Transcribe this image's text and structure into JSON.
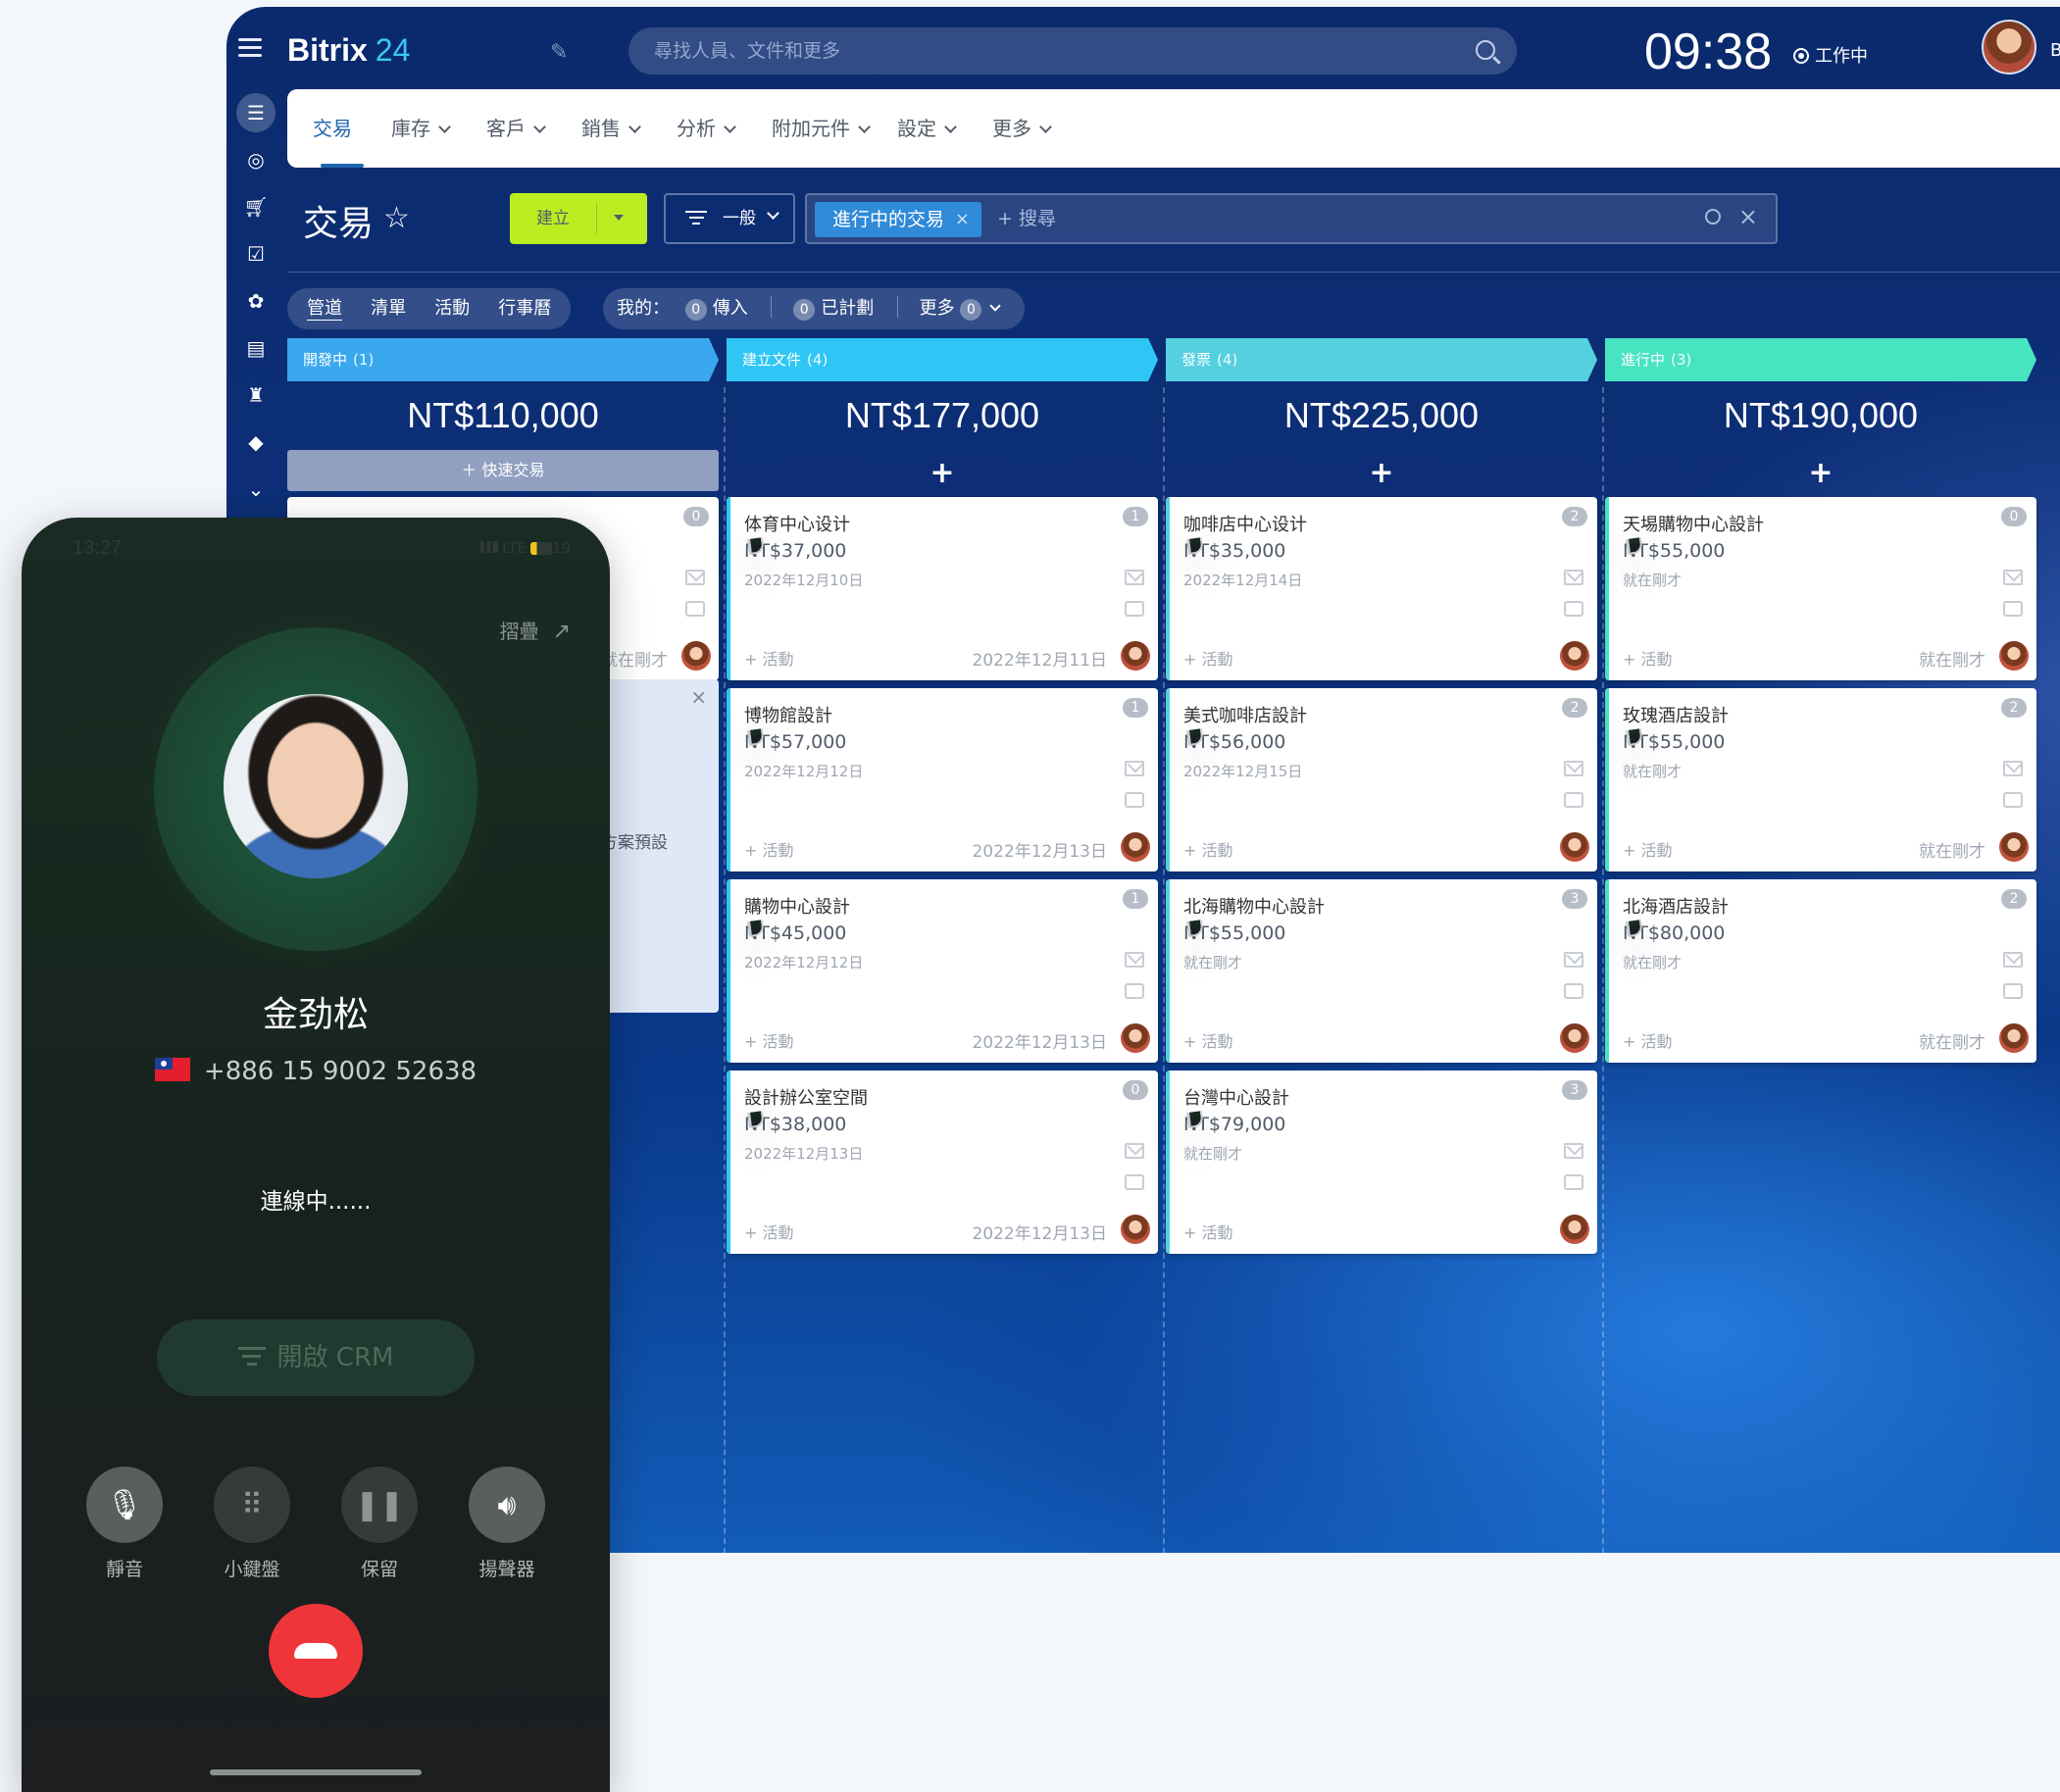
{
  "app": {
    "brand": "Bitrix",
    "brand_num": "24",
    "search_placeholder": "尋找人員、文件和更多",
    "clock": "09:38",
    "work_status": "工作中",
    "topbar_tail": "B"
  },
  "menu": [
    {
      "label": "交易",
      "active": true
    },
    {
      "label": "庫存"
    },
    {
      "label": "客戶"
    },
    {
      "label": "銷售"
    },
    {
      "label": "分析"
    },
    {
      "label": "附加元件"
    },
    {
      "label": "設定"
    },
    {
      "label": "更多"
    }
  ],
  "toolbar": {
    "title": "交易",
    "create": "建立",
    "filter": "一般",
    "chip": "進行中的交易",
    "search": "+ 搜尋"
  },
  "views": [
    "管道",
    "清單",
    "活動",
    "行事曆"
  ],
  "counters": {
    "mine": "我的：",
    "incoming_count": "0",
    "incoming": "傳入",
    "planned_count": "0",
    "planned": "已計劃",
    "more": "更多",
    "more_count": "0"
  },
  "columns": [
    {
      "name": "開發中",
      "count": "(1)",
      "sum": "NT$110,000",
      "color": "#39a8ef",
      "quick": "快速交易",
      "cards": [
        {
          "badge": "0",
          "date2": "就在剛才"
        }
      ],
      "partial": "方案預設"
    },
    {
      "name": "建立文件",
      "count": "(4)",
      "sum": "NT$177,000",
      "color": "#2fc6f6",
      "plus": "+",
      "cards": [
        {
          "title": "体育中心设计",
          "price": "NT$37,000",
          "date": "2022年12月10日",
          "act": "+ 活動",
          "date2": "2022年12月11日",
          "badge": "1"
        },
        {
          "title": "博物館設計",
          "price": "NT$57,000",
          "date": "2022年12月12日",
          "act": "+ 活動",
          "date2": "2022年12月13日",
          "badge": "1"
        },
        {
          "title": "購物中心設計",
          "price": "NT$45,000",
          "date": "2022年12月12日",
          "act": "+ 活動",
          "date2": "2022年12月13日",
          "badge": "1"
        },
        {
          "title": "設計辦公室空間",
          "price": "NT$38,000",
          "date": "2022年12月13日",
          "act": "+ 活動",
          "date2": "2022年12月13日",
          "badge": "0"
        }
      ]
    },
    {
      "name": "發票",
      "count": "(4)",
      "sum": "NT$225,000",
      "color": "#55d0e0",
      "plus": "+",
      "cards": [
        {
          "title": "咖啡店中心设计",
          "price": "NT$35,000",
          "date": "2022年12月14日",
          "act": "+ 活動",
          "date2": "",
          "badge": "2"
        },
        {
          "title": "美式咖啡店設計",
          "price": "NT$56,000",
          "date": "2022年12月15日",
          "act": "+ 活動",
          "date2": "",
          "badge": "2"
        },
        {
          "title": "北海購物中心設計",
          "price": "NT$55,000",
          "date": "就在剛才",
          "act": "+ 活動",
          "date2": "",
          "badge": "3"
        },
        {
          "title": "台灣中心設計",
          "price": "NT$79,000",
          "date": "就在剛才",
          "act": "+ 活動",
          "date2": "",
          "badge": "3"
        }
      ]
    },
    {
      "name": "進行中",
      "count": "(3)",
      "sum": "NT$190,000",
      "color": "#47e4c2",
      "plus": "+",
      "cards": [
        {
          "title": "天埸購物中心設計",
          "price": "NT$55,000",
          "date": "就在剛才",
          "act": "+ 活動",
          "date2": "就在剛才",
          "badge": "0"
        },
        {
          "title": "玫瑰酒店設計",
          "price": "NT$55,000",
          "date": "就在剛才",
          "act": "+ 活動",
          "date2": "就在剛才",
          "badge": "2"
        },
        {
          "title": "北海酒店設計",
          "price": "NT$80,000",
          "date": "就在剛才",
          "act": "+ 活動",
          "date2": "就在剛才",
          "badge": "2"
        }
      ]
    }
  ],
  "phone": {
    "time": "13:27",
    "network": "LTE",
    "battery": "19",
    "collapse": "摺疊",
    "name": "金劲松",
    "number": "+886 15 9002 52638",
    "state": "連線中......",
    "crm": "開啟 CRM",
    "controls": [
      "靜音",
      "小鍵盤",
      "保留",
      "揚聲器"
    ]
  },
  "colors": {
    "accent_green": "#bbed21",
    "accent_blue": "#2067b0",
    "hangup_red": "#f0353a"
  }
}
